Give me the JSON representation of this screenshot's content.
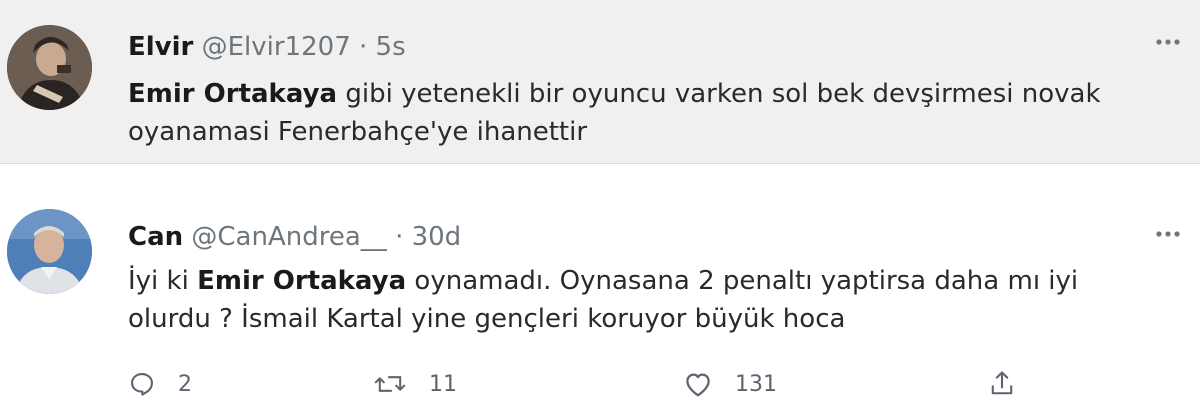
{
  "tweets": [
    {
      "author_name": "Elvir",
      "handle": "@Elvir1207",
      "separator": "·",
      "time": "5s",
      "line1_mention": "Emir Ortakaya",
      "line1_rest": " gibi yetenekli bir oyuncu varken sol bek devşirmesi novak",
      "line2": "oyanamasi Fenerbahçe'ye ihanettir",
      "avatar_icon": "profile-photo"
    },
    {
      "author_name": "Can",
      "handle": "@CanAndrea__",
      "separator": "·",
      "time": "30d",
      "line1_prefix": "İyi ki ",
      "line1_mention": "Emir Ortakaya",
      "line1_rest": " oynamadı. Oynasana 2 penaltı yaptirsa daha mı iyi",
      "line2": "olurdu ? İsmail Kartal yine gençleri koruyor büyük hoca",
      "avatar_icon": "profile-photo",
      "actions": {
        "reply_count": "2",
        "retweet_count": "11",
        "like_count": "131"
      }
    }
  ],
  "icons": {
    "more": "more-horizontal-icon",
    "reply": "reply-icon",
    "retweet": "retweet-icon",
    "like": "heart-icon",
    "share": "share-icon"
  },
  "colors": {
    "highlight_background": "#f0f0f0",
    "muted_text": "#6e767d",
    "icon_gray": "#5b6470"
  }
}
